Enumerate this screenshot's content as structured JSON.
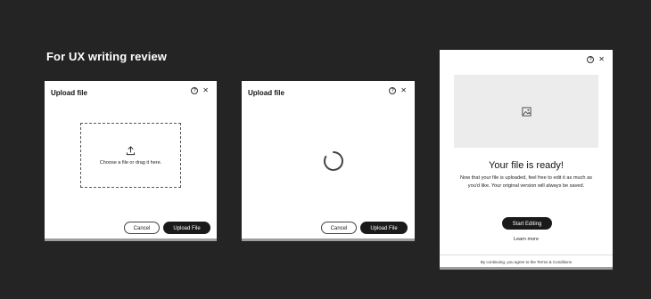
{
  "heading": "For UX writing review",
  "dialog_upload": {
    "title": "Upload file",
    "drop_text": "Choose a file or drag it here.",
    "cancel_label": "Cancel",
    "upload_label": "Upload File"
  },
  "dialog_loading": {
    "title": "Upload file",
    "cancel_label": "Cancel",
    "upload_label": "Upload File"
  },
  "dialog_ready": {
    "title": "Your file is ready!",
    "body": "Now that your file is uploaded, feel free to edit it as much as you'd like. Your original version will always be saved.",
    "start_label": "Start Editing",
    "learn_more": "Learn more",
    "footer": "By continuing, you agree to the Terms & Conditions"
  },
  "icons": {
    "help": "help-circle-icon",
    "close": "close-icon",
    "upload": "upload-icon",
    "spinner": "loading-spinner-icon",
    "image": "image-placeholder-icon"
  },
  "colors": {
    "background": "#242424",
    "primary_button": "#1a1a1a",
    "preview_placeholder": "#ececec"
  }
}
